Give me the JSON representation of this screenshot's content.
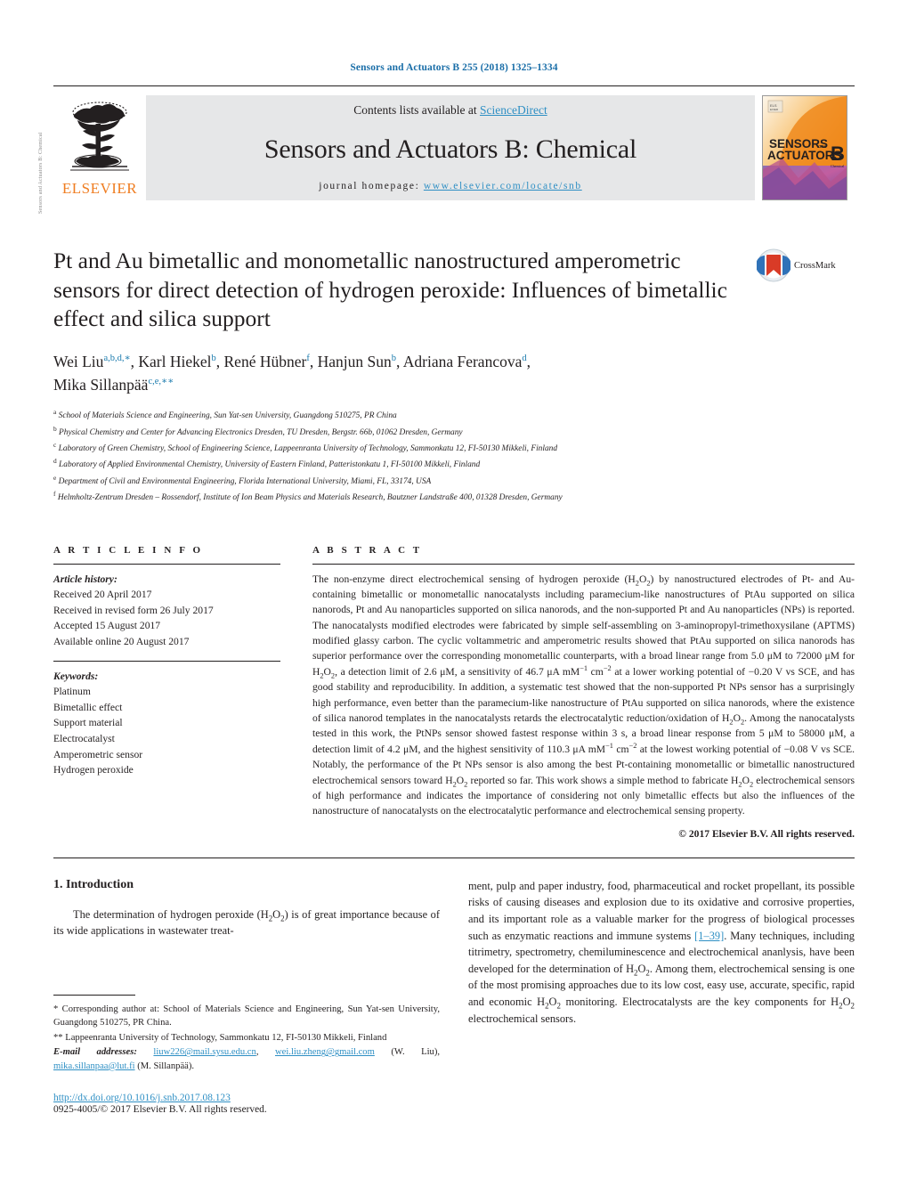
{
  "running_head": "Sensors and Actuators B 255 (2018) 1325–1334",
  "masthead": {
    "publisher": "ELSEVIER",
    "contents_prefix": "Contents lists available at ",
    "contents_link": "ScienceDirect",
    "journal_name": "Sensors and Actuators B: Chemical",
    "homepage_prefix": "journal homepage: ",
    "homepage_url": "www.elsevier.com/locate/snb",
    "cover_line1": "SENSORS",
    "cover_and": "and",
    "cover_line2": "ACTUATORS",
    "cover_letter": "B",
    "cover_sub": "Chemical"
  },
  "side_strip": "Sensors and Actuators B: Chemical",
  "article": {
    "title": "Pt and Au bimetallic and monometallic nanostructured amperometric sensors for direct detection of hydrogen peroxide: Influences of bimetallic effect and silica support",
    "crossmark_label": "CrossMark",
    "authors_line1_a": "Wei Liu",
    "authors_line1_a_sup": "a,b,d,",
    "authors_line1_b": ", Karl Hiekel",
    "authors_line1_b_sup": "b",
    "authors_line1_c": ", René Hübner",
    "authors_line1_c_sup": "f",
    "authors_line1_d": ", Hanjun Sun",
    "authors_line1_d_sup": "b",
    "authors_line1_e": ", Adriana Ferancova",
    "authors_line1_e_sup": "d",
    "authors_line2_a": "Mika Sillanpää",
    "authors_line2_a_sup": "c,e,",
    "affiliations": [
      {
        "mark": "a",
        "text": "School of Materials Science and Engineering, Sun Yat-sen University, Guangdong 510275, PR China"
      },
      {
        "mark": "b",
        "text": "Physical Chemistry and Center for Advancing Electronics Dresden, TU Dresden, Bergstr. 66b, 01062 Dresden, Germany"
      },
      {
        "mark": "c",
        "text": "Laboratory of Green Chemistry, School of Engineering Science, Lappeenranta University of Technology, Sammonkatu 12, FI-50130 Mikkeli, Finland"
      },
      {
        "mark": "d",
        "text": "Laboratory of Applied Environmental Chemistry, University of Eastern Finland, Patteristonkatu 1, FI-50100 Mikkeli, Finland"
      },
      {
        "mark": "e",
        "text": "Department of Civil and Environmental Engineering, Florida International University, Miami, FL, 33174, USA"
      },
      {
        "mark": "f",
        "text": "Helmholtz-Zentrum Dresden – Rossendorf, Institute of Ion Beam Physics and Materials Research, Bautzner Landstraße 400, 01328 Dresden, Germany"
      }
    ]
  },
  "article_info": {
    "heading": "A R T I C L E   I N F O",
    "history_label": "Article history:",
    "history": [
      "Received 20 April 2017",
      "Received in revised form 26 July 2017",
      "Accepted 15 August 2017",
      "Available online 20 August 2017"
    ],
    "keywords_label": "Keywords:",
    "keywords": [
      "Platinum",
      "Bimetallic effect",
      "Support material",
      "Electrocatalyst",
      "Amperometric sensor",
      "Hydrogen peroxide"
    ]
  },
  "abstract": {
    "heading": "A B S T R A C T",
    "text": "The non-enzyme direct electrochemical sensing of hydrogen peroxide (H2O2) by nanostructured electrodes of Pt- and Au-containing bimetallic or monometallic nanocatalysts including paramecium-like nanostructures of PtAu supported on silica nanorods, Pt and Au nanoparticles supported on silica nanorods, and the non-supported Pt and Au nanoparticles (NPs) is reported. The nanocatalysts modified electrodes were fabricated by simple self-assembling on 3-aminopropyl-trimethoxysilane (APTMS) modified glassy carbon. The cyclic voltammetric and amperometric results showed that PtAu supported on silica nanorods has superior performance over the corresponding monometallic counterparts, with a broad linear range from 5.0 μM to 72000 μM for H2O2, a detection limit of 2.6 μM, a sensitivity of 46.7 μA mM−1 cm−2 at a lower working potential of −0.20 V vs SCE, and has good stability and reproducibility. In addition, a systematic test showed that the non-supported Pt NPs sensor has a surprisingly high performance, even better than the paramecium-like nanostructure of PtAu supported on silica nanorods, where the existence of silica nanorod templates in the nanocatalysts retards the electrocatalytic reduction/oxidation of H2O2. Among the nanocatalysts tested in this work, the PtNPs sensor showed fastest response within 3 s, a broad linear response from 5 μM to 58000 μM, a detection limit of 4.2 μM, and the highest sensitivity of 110.3 μA mM−1 cm−2 at the lowest working potential of −0.08 V vs SCE. Notably, the performance of the Pt NPs sensor is also among the best Pt-containing monometallic or bimetallic nanostructured electrochemical sensors toward H2O2 reported so far. This work shows a simple method to fabricate H2O2 electrochemical sensors of high performance and indicates the importance of considering not only bimetallic effects but also the influences of the nanostructure of nanocatalysts on the electrocatalytic performance and electrochemical sensing property.",
    "copyright": "© 2017 Elsevier B.V. All rights reserved."
  },
  "introduction": {
    "heading": "1.  Introduction",
    "left_paragraph": "The determination of hydrogen peroxide (H2O2) is of great importance because of its wide applications in wastewater treat-",
    "right_paragraph_a": "ment, pulp and paper industry, food, pharmaceutical and rocket propellant, its possible risks of causing diseases and explosion due to its oxidative and corrosive properties, and its important role as a valuable marker for the progress of biological processes such as enzymatic reactions and immune systems ",
    "right_reference": "[1–39]",
    "right_paragraph_b": ". Many techniques, including titrimetry, spectrometry, chemiluminescence and electrochemical ananlysis, have been developed for the determination of H2O2. Among them, electrochemical sensing is one of the most promising approaches due to its low cost, easy use, accurate, specific, rapid and economic H2O2 monitoring. Electrocatalysts are the key components for H2O2 electrochemical sensors."
  },
  "footnotes": {
    "corresponding": "* Corresponding author at: School of Materials Science and Engineering, Sun Yat-sen University, Guangdong 510275, PR China.",
    "corresponding2": "** Lappeenranta University of Technology, Sammonkatu 12, FI-50130 Mikkeli, Finland",
    "email_label": "E-mail addresses:",
    "email1": "liuw226@mail.sysu.edu.cn",
    "email2": "wei.liu.zheng@gmail.com",
    "email1_owner": "(W. Liu),",
    "email3": "mika.sillanpaa@lut.fi",
    "email3_owner": "(M. Sillanpää).",
    "doi": "http://dx.doi.org/10.1016/j.snb.2017.08.123",
    "issn": "0925-4005/© 2017 Elsevier B.V. All rights reserved."
  },
  "colors": {
    "link": "#2e8fc4",
    "runhead": "#1a6ea8",
    "elsevier_orange": "#ef7d21",
    "band_gray": "#e6e7e8"
  }
}
